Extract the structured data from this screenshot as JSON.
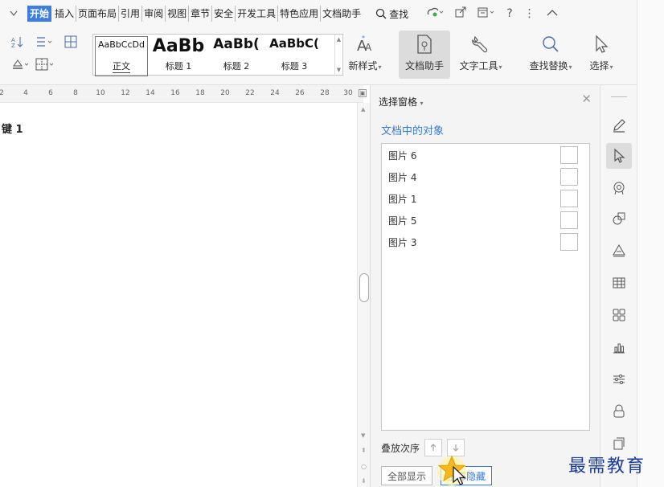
{
  "menubar": {
    "dropdown_icon": "chevron-down-icon",
    "tabs": [
      {
        "label": "开始",
        "active": true
      },
      {
        "label": "插入"
      },
      {
        "label": "页面布局"
      },
      {
        "label": "引用"
      },
      {
        "label": "审阅"
      },
      {
        "label": "视图"
      },
      {
        "label": "章节"
      },
      {
        "label": "安全"
      },
      {
        "label": "开发工具"
      },
      {
        "label": "特色应用"
      },
      {
        "label": "文档助手"
      }
    ],
    "search_label": "查找",
    "right_icons": [
      "cloud-sync-icon",
      "share-icon",
      "layout-icon",
      "help-icon",
      "more-icon",
      "collapse-icon"
    ]
  },
  "ribbon": {
    "styles": [
      {
        "sample": "AaBbCcDd",
        "caption": "正文"
      },
      {
        "sample": "AaBb",
        "caption": "标题 1"
      },
      {
        "sample": "AaBb(",
        "caption": "标题 2"
      },
      {
        "sample": "AaBbC(",
        "caption": "标题 3"
      }
    ],
    "new_style_label": "新样式",
    "doc_assistant_label": "文档助手",
    "text_tools_label": "文字工具",
    "find_replace_label": "查找替换",
    "select_label": "选择",
    "accent_color": "#3b7de0"
  },
  "ruler": {
    "ticks": [
      "2",
      "4",
      "6",
      "8",
      "10",
      "12",
      "14",
      "16",
      "18",
      "20",
      "22",
      "24",
      "26",
      "28",
      "30"
    ]
  },
  "document": {
    "visible_text": "键 1"
  },
  "selection_pane": {
    "title": "选择窗格",
    "subtitle": "文档中的对象",
    "objects": [
      "图片 6",
      "图片 4",
      "图片 1",
      "图片 5",
      "图片 3"
    ],
    "order_label": "叠放次序",
    "show_all_label": "全部显示",
    "hide_all_label": "全部隐藏"
  },
  "toolstrip": {
    "icons": [
      "pen-icon",
      "select-cursor-icon",
      "badge-icon",
      "shapes-icon",
      "layers-icon",
      "table-icon",
      "grid-icon",
      "chart-icon",
      "settings-sliders-icon",
      "lock-icon",
      "export-icon"
    ]
  },
  "watermark": {
    "text": "最需教育"
  }
}
